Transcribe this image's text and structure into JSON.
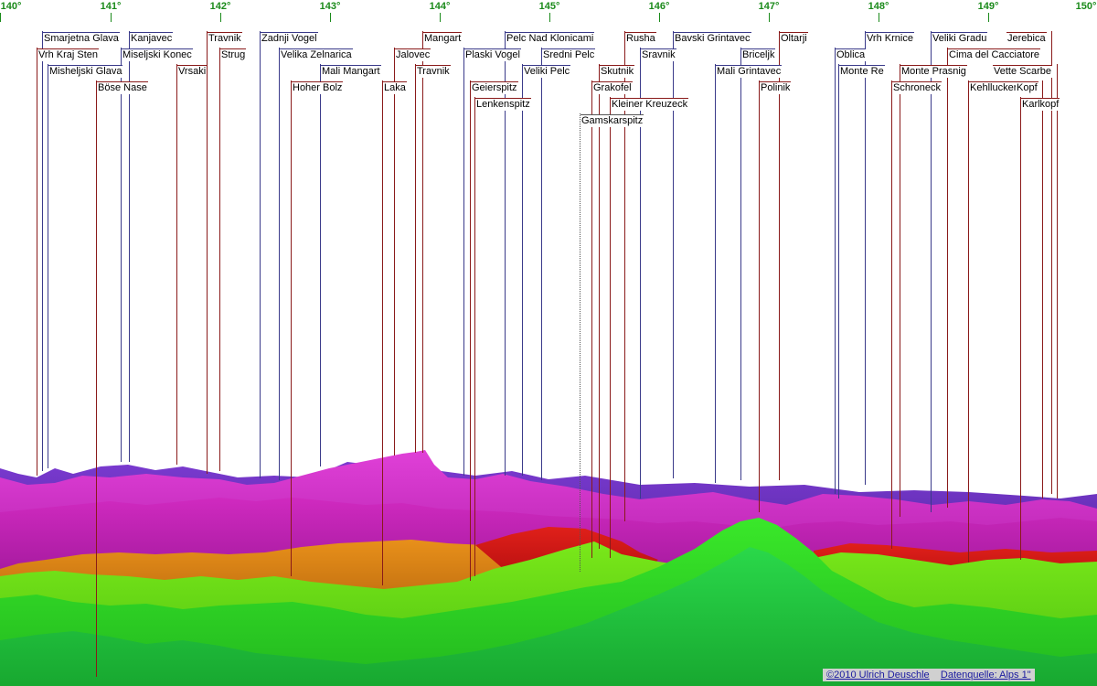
{
  "panorama": {
    "degree_ticks": [
      {
        "label": "140°"
      },
      {
        "label": "141°"
      },
      {
        "label": "142°"
      },
      {
        "label": "143°"
      },
      {
        "label": "144°"
      },
      {
        "label": "145°"
      },
      {
        "label": "146°"
      },
      {
        "label": "147°"
      },
      {
        "label": "148°"
      },
      {
        "label": "149°"
      },
      {
        "label": "150°"
      }
    ],
    "peaks": [
      {
        "name": "Smarjetna Glava",
        "color": "#3a3a8a"
      },
      {
        "name": "Kanjavec",
        "color": "#3a3a8a"
      },
      {
        "name": "Travnik",
        "color": "#8a1a1a"
      },
      {
        "name": "Zadnji Vogel",
        "color": "#3a3a8a"
      },
      {
        "name": "Mangart",
        "color": "#8a1a1a"
      },
      {
        "name": "Pelc Nad Klonicami",
        "color": "#3a3a8a"
      },
      {
        "name": "Rusha",
        "color": "#8a1a1a"
      },
      {
        "name": "Bavski Grintavec",
        "color": "#3a3a8a"
      },
      {
        "name": "Oltarji",
        "color": "#8a1a1a"
      },
      {
        "name": "Vrh Krnice",
        "color": "#3a3a8a"
      },
      {
        "name": "Veliki Gradu",
        "color": "#3a3a8a"
      },
      {
        "name": "Jerebica",
        "color": "#8a1a1a"
      },
      {
        "name": "Vrh Kraj Sten",
        "color": "#8a1a1a"
      },
      {
        "name": "Miseljski Konec",
        "color": "#3a3a8a"
      },
      {
        "name": "Strug",
        "color": "#8a1a1a"
      },
      {
        "name": "Velika Zelnarica",
        "color": "#3a3a8a"
      },
      {
        "name": "Jalovec",
        "color": "#8a1a1a"
      },
      {
        "name": "Plaski Vogel",
        "color": "#3a3a8a"
      },
      {
        "name": "Sredni Pelc",
        "color": "#3a3a8a"
      },
      {
        "name": "Sravnik",
        "color": "#3a3a8a"
      },
      {
        "name": "Briceljk",
        "color": "#3a3a8a"
      },
      {
        "name": "Oblica",
        "color": "#3a3a8a"
      },
      {
        "name": "Cima del Cacciatore",
        "color": "#8a1a1a"
      },
      {
        "name": "Misheljski Glava",
        "color": "#3a3a8a"
      },
      {
        "name": "Vrsaki",
        "color": "#8a1a1a"
      },
      {
        "name": "Mali Mangart",
        "color": "#3a3a8a"
      },
      {
        "name": "Travnik",
        "color": "#8a1a1a"
      },
      {
        "name": "Veliki Pelc",
        "color": "#3a3a8a"
      },
      {
        "name": "Skutnik",
        "color": "#8a1a1a"
      },
      {
        "name": "Mali Grintavec",
        "color": "#3a3a8a"
      },
      {
        "name": "Monte Re",
        "color": "#3a3a8a"
      },
      {
        "name": "Monte Prasnig",
        "color": "#8a1a1a"
      },
      {
        "name": "Vette Scarbe",
        "color": "#8a1a1a"
      },
      {
        "name": "Böse Nase",
        "color": "#8a1a1a"
      },
      {
        "name": "Hoher Bolz",
        "color": "#8a1a1a"
      },
      {
        "name": "Laka",
        "color": "#8a1a1a"
      },
      {
        "name": "Geierspitz",
        "color": "#8a1a1a"
      },
      {
        "name": "Grakofel",
        "color": "#8a1a1a"
      },
      {
        "name": "Polinik",
        "color": "#8a1a1a"
      },
      {
        "name": "Schroneck",
        "color": "#8a1a1a"
      },
      {
        "name": "Kehllucker",
        "color": "#8a1a1a"
      },
      {
        "name": "Kopf",
        "color": "#8a1a1a"
      },
      {
        "name": "Lenkenspitz",
        "color": "#8a1a1a"
      },
      {
        "name": "Kleiner Kreuzeck",
        "color": "#8a1a1a"
      },
      {
        "name": "Karlkopf",
        "color": "#8a1a1a"
      },
      {
        "name": "Gamskarspitz",
        "color": "#555555"
      }
    ],
    "credits": {
      "copyright": "©2010 Ulrich Deuschle",
      "source": "Datenquelle: Alps 1\""
    }
  }
}
